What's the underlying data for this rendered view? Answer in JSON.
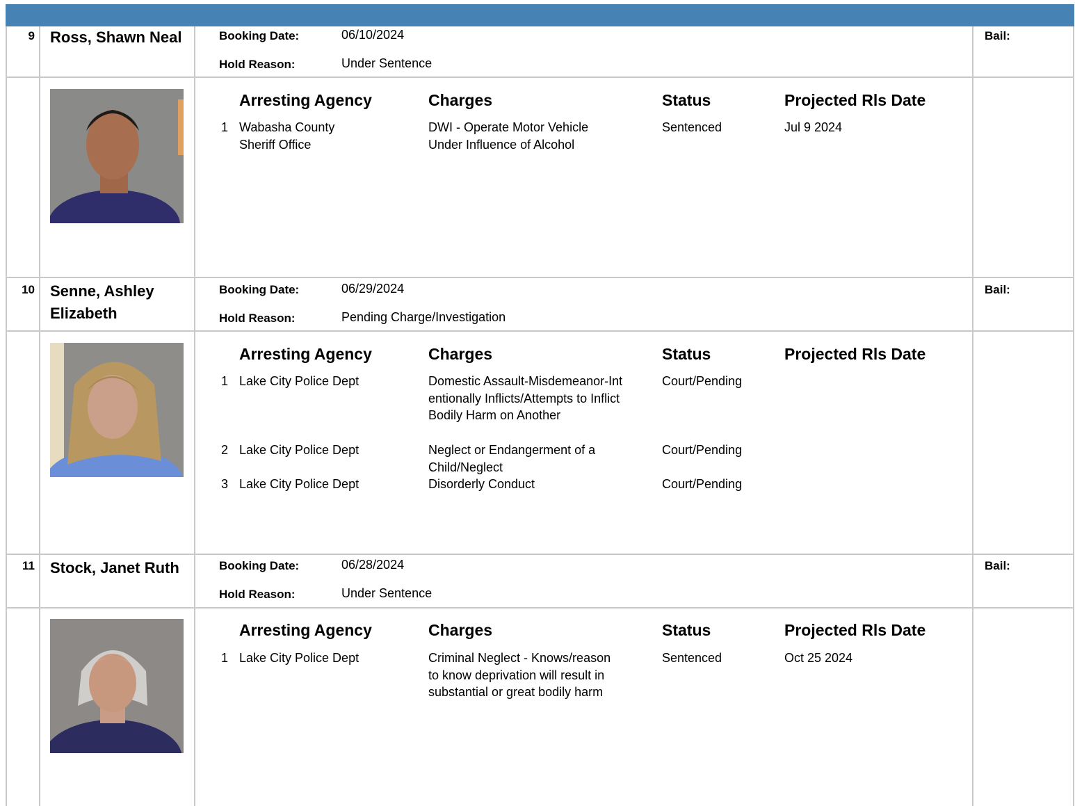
{
  "columns": {
    "agency": "Arresting Agency",
    "charges": "Charges",
    "status": "Status",
    "release": "Projected Rls Date"
  },
  "labels": {
    "booking": "Booking Date:",
    "hold": "Hold Reason:",
    "bail": "Bail:"
  },
  "inmates": [
    {
      "number": "9",
      "name": "Ross, Shawn Neal",
      "booking_date": "06/10/2024",
      "hold_reason": "Under Sentence",
      "charges": [
        {
          "num": "1",
          "agency": "Wabasha County Sheriff Office",
          "charge": "DWI - Operate Motor Vehicle Under Influence of Alcohol",
          "status": "Sentenced",
          "release": "Jul 9 2024"
        }
      ]
    },
    {
      "number": "10",
      "name": "Senne, Ashley Elizabeth",
      "booking_date": "06/29/2024",
      "hold_reason": "Pending Charge/Investigation",
      "charges": [
        {
          "num": "1",
          "agency": "Lake City Police Dept",
          "charge": "Domestic Assault-Misdemeanor-Intentionally Inflicts/Attempts to Inflict Bodily Harm on Another",
          "status": "Court/Pending",
          "release": ""
        },
        {
          "num": "2",
          "agency": "Lake City Police Dept",
          "charge": "Neglect or Endangerment of a Child/Neglect",
          "status": "Court/Pending",
          "release": ""
        },
        {
          "num": "3",
          "agency": "Lake City Police Dept",
          "charge": "Disorderly Conduct",
          "status": "Court/Pending",
          "release": ""
        }
      ]
    },
    {
      "number": "11",
      "name": "Stock, Janet Ruth",
      "booking_date": "06/28/2024",
      "hold_reason": "Under Sentence",
      "charges": [
        {
          "num": "1",
          "agency": "Lake City Police Dept",
          "charge": "Criminal Neglect - Knows/reason to know deprivation will result in substantial or great bodily harm",
          "status": "Sentenced",
          "release": "Oct 25 2024"
        }
      ]
    }
  ],
  "colors": {
    "header_bar": "#4682b4",
    "grid": "#c8c8c8"
  }
}
